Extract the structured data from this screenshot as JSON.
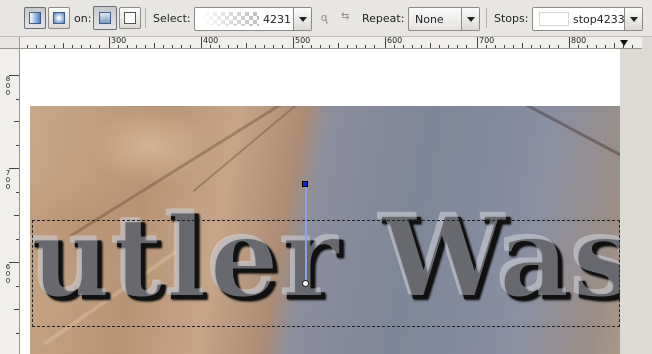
{
  "toolbar": {
    "mode_icons": [
      "linear-gradient-icon",
      "radial-gradient-icon"
    ],
    "on_label": "on:",
    "target_icons": [
      "fill-target-icon",
      "stroke-target-icon"
    ],
    "select_label": "Select:",
    "select_gradient_value": "4231",
    "lock_icon": "lock-icon",
    "reverse_icon": "reverse-icon",
    "repeat_label": "Repeat:",
    "repeat_value": "None",
    "stops_label": "Stops:",
    "stops_value": "stop4233"
  },
  "ruler": {
    "horizontal_labels": [
      "300",
      "400",
      "500",
      "600",
      "700",
      "800"
    ],
    "vertical_labels": [
      "8\n0\n0",
      "7\n0\n0",
      "6\n0\n0"
    ]
  },
  "canvas": {
    "text": "utler Wash",
    "handle_start_color": "#1020d8",
    "handle_line_color": "#8aa0e8"
  },
  "colors": {
    "toolbar_bg": "#e8e6e2",
    "accent": "#4a7fbf"
  }
}
